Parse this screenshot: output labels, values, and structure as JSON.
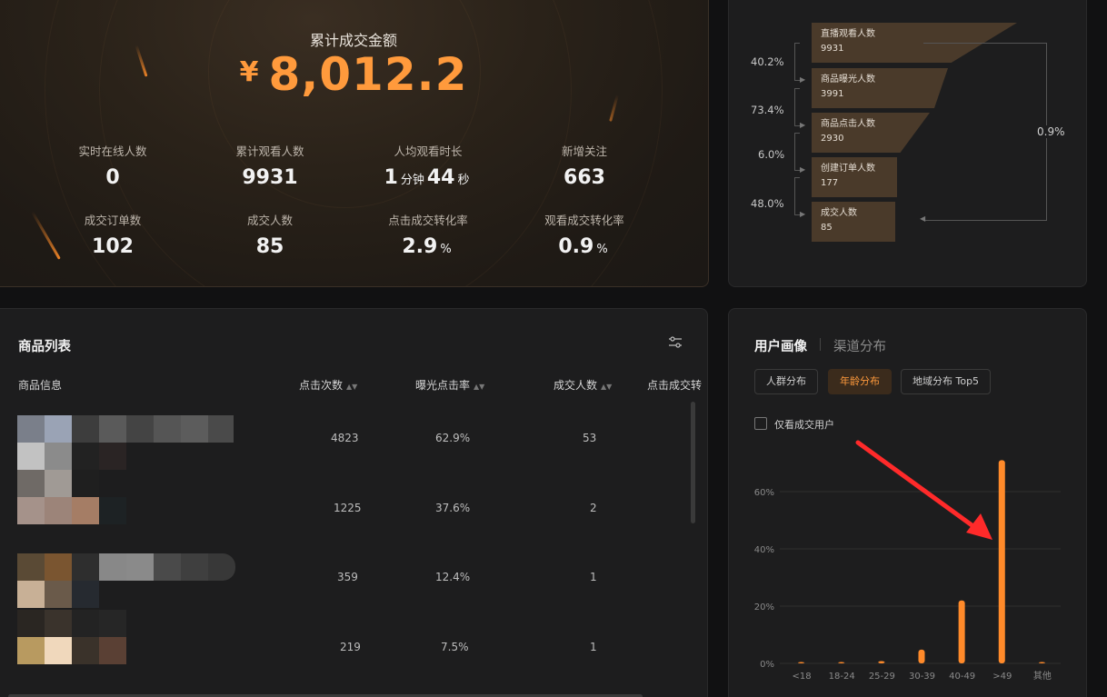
{
  "summary": {
    "title": "累计成交金额",
    "currency": "¥",
    "amount": "8,012.2",
    "stats": [
      {
        "label": "实时在线人数",
        "value": "0"
      },
      {
        "label": "累计观看人数",
        "value": "9931"
      },
      {
        "label": "人均观看时长",
        "minutes": "1",
        "minutes_unit": "分钟",
        "seconds": "44",
        "seconds_unit": "秒"
      },
      {
        "label": "新增关注",
        "value": "663"
      },
      {
        "label": "成交订单数",
        "value": "102"
      },
      {
        "label": "成交人数",
        "value": "85"
      },
      {
        "label": "点击成交转化率",
        "value": "2.9",
        "unit": "%"
      },
      {
        "label": "观看成交转化率",
        "value": "0.9",
        "unit": "%"
      }
    ]
  },
  "funnel": {
    "stages": [
      {
        "label": "直播观看人数",
        "value": "9931"
      },
      {
        "label": "商品曝光人数",
        "value": "3991"
      },
      {
        "label": "商品点击人数",
        "value": "2930"
      },
      {
        "label": "创建订单人数",
        "value": "177"
      },
      {
        "label": "成交人数",
        "value": "85"
      }
    ],
    "step_rates": [
      "40.2%",
      "73.4%",
      "6.0%",
      "48.0%"
    ],
    "overall_rate": "0.9%"
  },
  "product_list": {
    "title": "商品列表",
    "columns": [
      "商品信息",
      "点击次数",
      "曝光点击率",
      "成交人数",
      "点击成交转"
    ],
    "rows": [
      {
        "clicks": "4823",
        "ctr": "62.9%",
        "buyers": "53"
      },
      {
        "clicks": "1225",
        "ctr": "37.6%",
        "buyers": "2"
      },
      {
        "clicks": "359",
        "ctr": "12.4%",
        "buyers": "1"
      },
      {
        "clicks": "219",
        "ctr": "7.5%",
        "buyers": "1"
      }
    ]
  },
  "portrait": {
    "tab_active": "用户画像",
    "tab_other": "渠道分布",
    "segments": [
      "人群分布",
      "年龄分布",
      "地域分布 Top5"
    ],
    "active_segment": "年龄分布",
    "checkbox_label": "仅看成交用户",
    "accent_color": "#ff8a2a"
  },
  "chart_data": {
    "type": "bar",
    "categories": [
      "<18",
      "18-24",
      "25-29",
      "30-39",
      "40-49",
      ">49",
      "其他"
    ],
    "values": [
      0.1,
      0.1,
      0.8,
      4.8,
      22.0,
      71.0,
      0.1
    ],
    "ylim": [
      0,
      70
    ],
    "yticks": [
      "0%",
      "20%",
      "40%",
      "60%"
    ],
    "grid": true
  }
}
